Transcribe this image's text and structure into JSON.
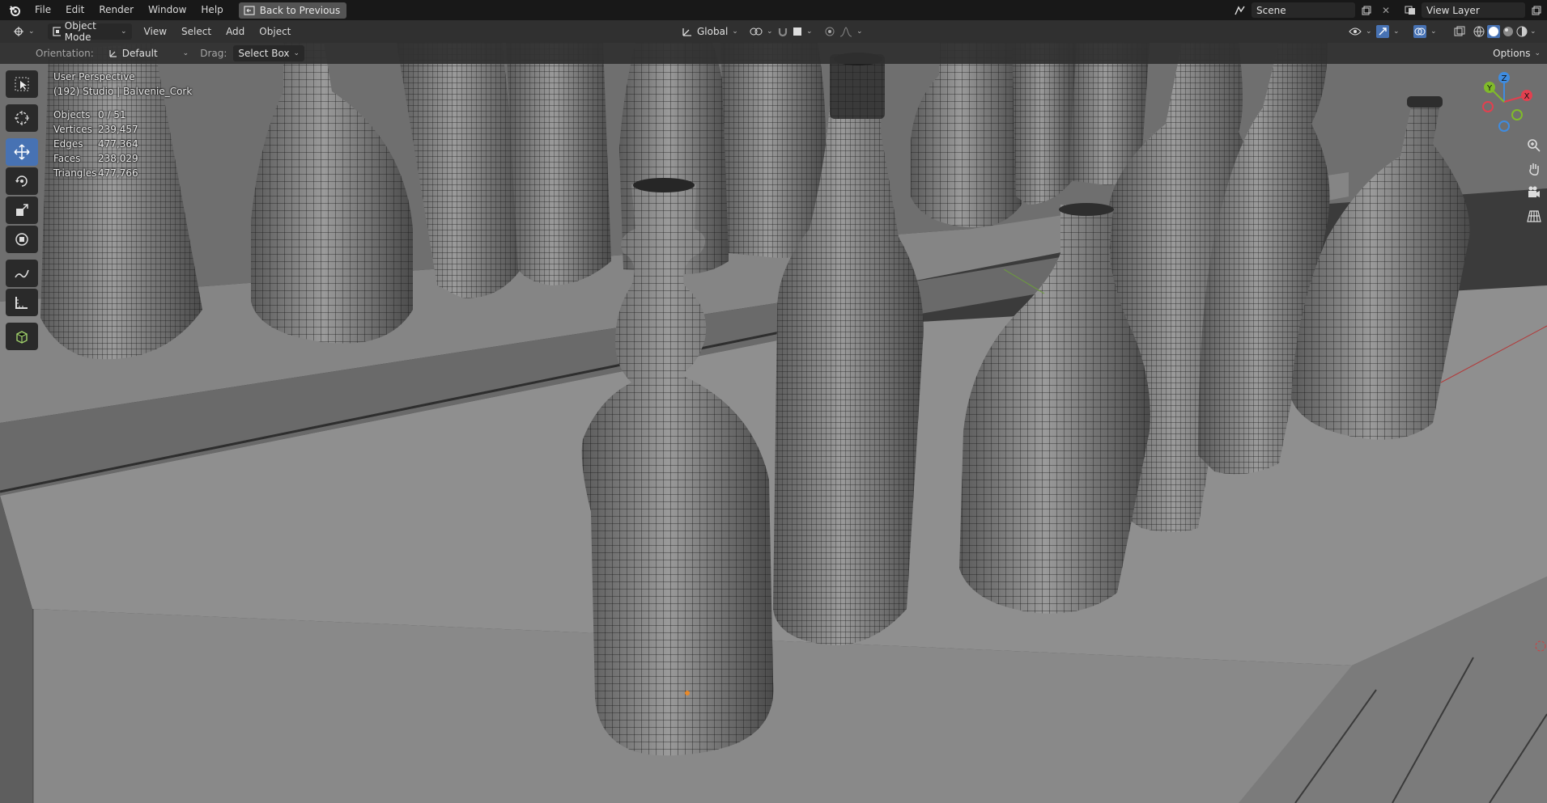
{
  "menu": {
    "items": [
      "File",
      "Edit",
      "Render",
      "Window",
      "Help"
    ],
    "back_label": "Back to Previous"
  },
  "scene": {
    "scene_name": "Scene",
    "view_layer": "View Layer"
  },
  "header": {
    "mode": "Object Mode",
    "menus": [
      "View",
      "Select",
      "Add",
      "Object"
    ],
    "transform_orientation": "Global"
  },
  "toolbar": {
    "orientation_label": "Orientation:",
    "orientation_value": "Default",
    "drag_label": "Drag:",
    "drag_value": "Select Box",
    "options_label": "Options"
  },
  "viewport": {
    "perspective": "User Perspective",
    "active_object": "(192) Studio | Balvenie_Cork"
  },
  "stats": [
    {
      "key": "Objects",
      "value": "0 / 51"
    },
    {
      "key": "Vertices",
      "value": "239,457"
    },
    {
      "key": "Edges",
      "value": "477,364"
    },
    {
      "key": "Faces",
      "value": "238,029"
    },
    {
      "key": "Triangles",
      "value": "477,766"
    }
  ],
  "gizmo_axes": {
    "x": "X",
    "y": "Y",
    "z": "Z"
  },
  "tool_icons": [
    "select-box-icon",
    "cursor-icon",
    "move-icon",
    "rotate-icon",
    "scale-icon",
    "transform-icon",
    "annotate-icon",
    "measure-icon",
    "add-cube-icon"
  ],
  "colors": {
    "accent": "#4772b3",
    "axis_x": "#e2404f",
    "axis_y": "#80bb2a",
    "axis_z": "#3f8ce0"
  }
}
